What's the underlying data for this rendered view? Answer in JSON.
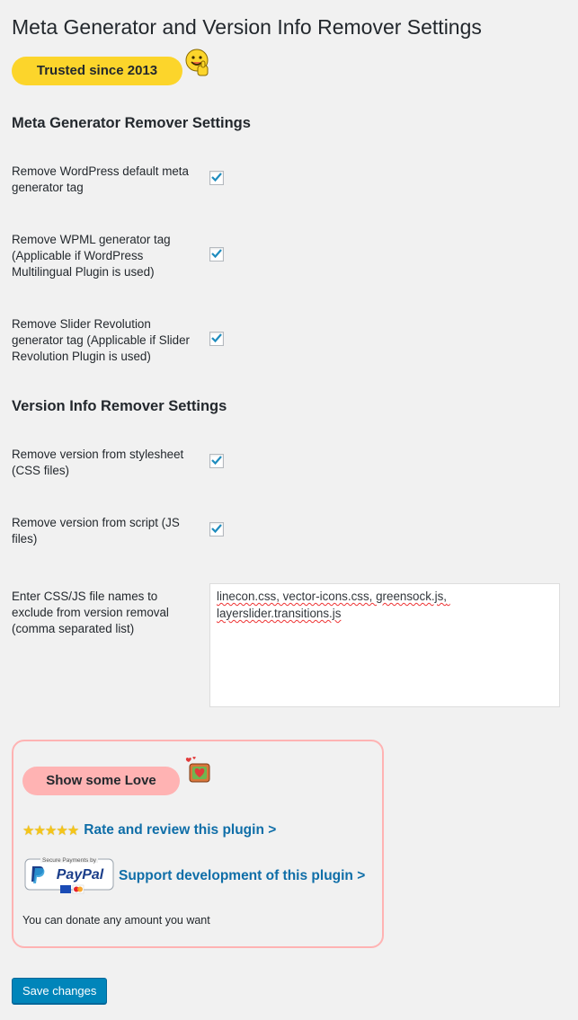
{
  "page": {
    "title": "Meta Generator and Version Info Remover Settings",
    "trusted_badge": "Trusted since 2013"
  },
  "meta_section": {
    "title": "Meta Generator Remover Settings",
    "rows": [
      {
        "label": "Remove WordPress default meta generator tag",
        "checked": true
      },
      {
        "label": "Remove WPML generator tag (Applicable if WordPress Multilingual Plugin is used)",
        "checked": true
      },
      {
        "label": "Remove Slider Revolution generator tag (Applicable if Slider Revolution Plugin is used)",
        "checked": true
      }
    ]
  },
  "version_section": {
    "title": "Version Info Remover Settings",
    "rows": [
      {
        "label": "Remove version from stylesheet (CSS files)",
        "checked": true
      },
      {
        "label": "Remove version from script (JS files)",
        "checked": true
      }
    ],
    "exclude_label": "Enter CSS/JS file names to exclude from version removal (comma separated list)",
    "exclude_value": "linecon.css, vector-icons.css, greensock.js, layerslider.transitions.js"
  },
  "love_box": {
    "badge": "Show some Love",
    "stars": "★★★★★",
    "rate_link": "Rate and review this plugin >",
    "paypal_secure_text": "Secure Payments by",
    "paypal_brand": "PayPal",
    "support_link": "Support development of this plugin >",
    "donate_note": "You can donate any amount you want"
  },
  "actions": {
    "save_label": "Save changes"
  },
  "colors": {
    "background": "#f1f1f1",
    "trusted_badge": "#fcd52b",
    "love_badge": "#ffb3b3",
    "link": "#0f6ea8",
    "primary_button": "#0085ba",
    "checkmark": "#1e8cbe"
  },
  "icons": {
    "trusted": "thumbs-up-smiley-icon",
    "love": "heart-gift-box-icon",
    "checkbox": "checkmark-icon"
  }
}
